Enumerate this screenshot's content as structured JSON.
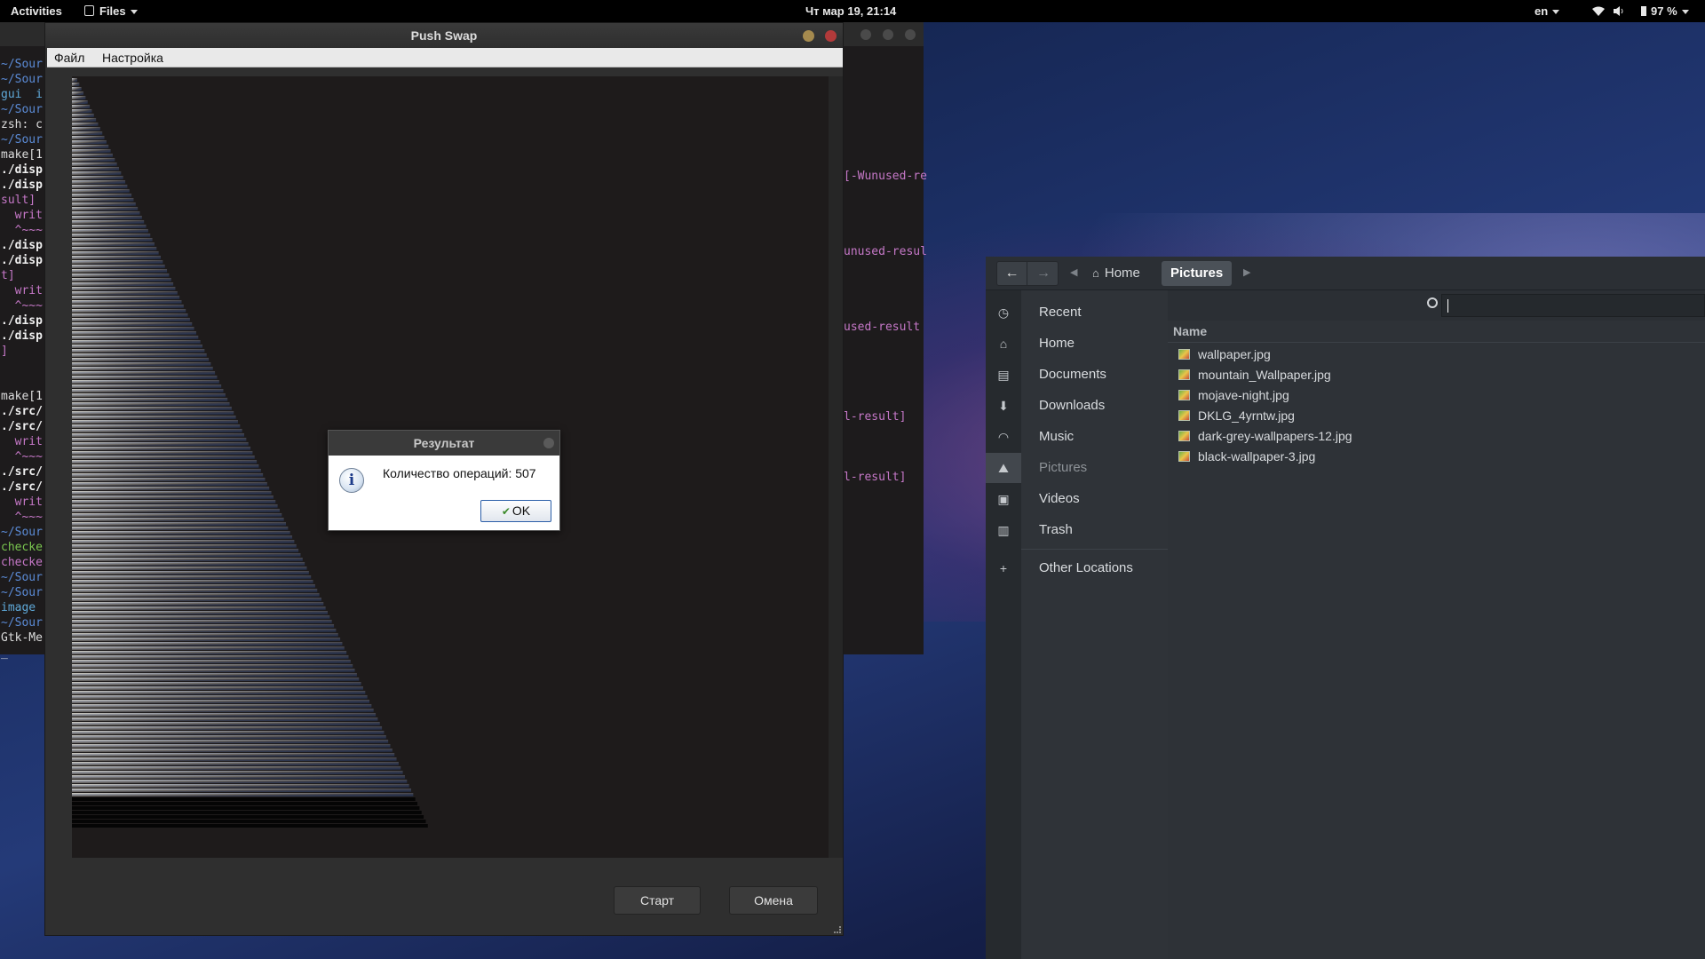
{
  "topbar": {
    "activities": "Activities",
    "app_menu": "Files",
    "clock": "Чт мар 19, 21:14",
    "lang": "en",
    "battery": "97 %"
  },
  "terminal": {
    "left_lines": [
      {
        "t": "~/Sour",
        "c": "#5b8bd6",
        "b": false
      },
      {
        "t": "~/Sour",
        "c": "#5b8bd6",
        "b": false
      },
      {
        "t": "gui  i",
        "c": "#5fa9d9",
        "b": false
      },
      {
        "t": "~/Sour",
        "c": "#5b8bd6",
        "b": false
      },
      {
        "t": "zsh: c",
        "c": "#dddddd",
        "b": false
      },
      {
        "t": "~/Sour",
        "c": "#5b8bd6",
        "b": false
      },
      {
        "t": "make[1",
        "c": "#dddddd",
        "b": false
      },
      {
        "t": "./disp",
        "c": "#f0f0f0",
        "b": true
      },
      {
        "t": "./disp",
        "c": "#f0f0f0",
        "b": true
      },
      {
        "t": "sult]",
        "c": "#c678c8",
        "b": false
      },
      {
        "t": "  writ",
        "c": "#c678c8",
        "b": false
      },
      {
        "t": "  ^~~~",
        "c": "#c678c8",
        "b": false
      },
      {
        "t": "./disp",
        "c": "#f0f0f0",
        "b": true
      },
      {
        "t": "./disp",
        "c": "#f0f0f0",
        "b": true
      },
      {
        "t": "t]",
        "c": "#c678c8",
        "b": false
      },
      {
        "t": "  writ",
        "c": "#c678c8",
        "b": false
      },
      {
        "t": "  ^~~~",
        "c": "#c678c8",
        "b": false
      },
      {
        "t": "./disp",
        "c": "#f0f0f0",
        "b": true
      },
      {
        "t": "./disp",
        "c": "#f0f0f0",
        "b": true
      },
      {
        "t": "]",
        "c": "#c678c8",
        "b": false
      },
      {
        "t": "",
        "c": "#dddddd",
        "b": false
      },
      {
        "t": "",
        "c": "#dddddd",
        "b": false
      },
      {
        "t": "make[1",
        "c": "#dddddd",
        "b": false
      },
      {
        "t": "./src/",
        "c": "#f0f0f0",
        "b": true
      },
      {
        "t": "./src/",
        "c": "#f0f0f0",
        "b": true
      },
      {
        "t": "  writ",
        "c": "#c678c8",
        "b": false
      },
      {
        "t": "  ^~~~",
        "c": "#c678c8",
        "b": false
      },
      {
        "t": "./src/",
        "c": "#f0f0f0",
        "b": true
      },
      {
        "t": "./src/",
        "c": "#f0f0f0",
        "b": true
      },
      {
        "t": "  writ",
        "c": "#c678c8",
        "b": false
      },
      {
        "t": "  ^~~~",
        "c": "#c678c8",
        "b": false
      },
      {
        "t": "~/Sour",
        "c": "#5b8bd6",
        "b": false
      },
      {
        "t": "checke",
        "c": "#7ac74f",
        "b": false
      },
      {
        "t": "checke",
        "c": "#c678c8",
        "b": false
      },
      {
        "t": "~/Sour",
        "c": "#5b8bd6",
        "b": false
      },
      {
        "t": "~/Sour",
        "c": "#5b8bd6",
        "b": false
      },
      {
        "t": "image",
        "c": "#5fa9d9",
        "b": false
      },
      {
        "t": "~/Sour",
        "c": "#5b8bd6",
        "b": false
      },
      {
        "t": "Gtk-Me",
        "c": "#dddddd",
        "b": false
      },
      {
        "t": "_",
        "c": "#dddddd",
        "b": false
      }
    ],
    "right_fragments": [
      "[-Wunused-re",
      "unused-resul",
      "used-result",
      "l-result]",
      "l-result]"
    ]
  },
  "push_swap": {
    "title": "Push Swap",
    "menu": [
      "Файл",
      "Настройка"
    ],
    "start_button": "Старт",
    "cancel_button": "Омена"
  },
  "dialog": {
    "title": "Результат",
    "message": "Количество операций: 507",
    "ok": "OK"
  },
  "files": {
    "breadcrumb": [
      "Home",
      "Pictures"
    ],
    "sidebar": [
      {
        "label": "Recent",
        "icon": "clock-icon"
      },
      {
        "label": "Home",
        "icon": "home-icon"
      },
      {
        "label": "Documents",
        "icon": "document-icon"
      },
      {
        "label": "Downloads",
        "icon": "download-icon"
      },
      {
        "label": "Music",
        "icon": "headphones-icon"
      },
      {
        "label": "Pictures",
        "icon": "picture-icon"
      },
      {
        "label": "Videos",
        "icon": "camera-icon"
      },
      {
        "label": "Trash",
        "icon": "trash-icon"
      },
      {
        "label": "Other Locations",
        "icon": "plus-icon"
      }
    ],
    "column_name": "Name",
    "files": [
      "wallpaper.jpg",
      "mountain_Wallpaper.jpg",
      "mojave-night.jpg",
      "DKLG_4yrntw.jpg",
      "dark-grey-wallpapers-12.jpg",
      "black-wallpaper-3.jpg"
    ]
  }
}
